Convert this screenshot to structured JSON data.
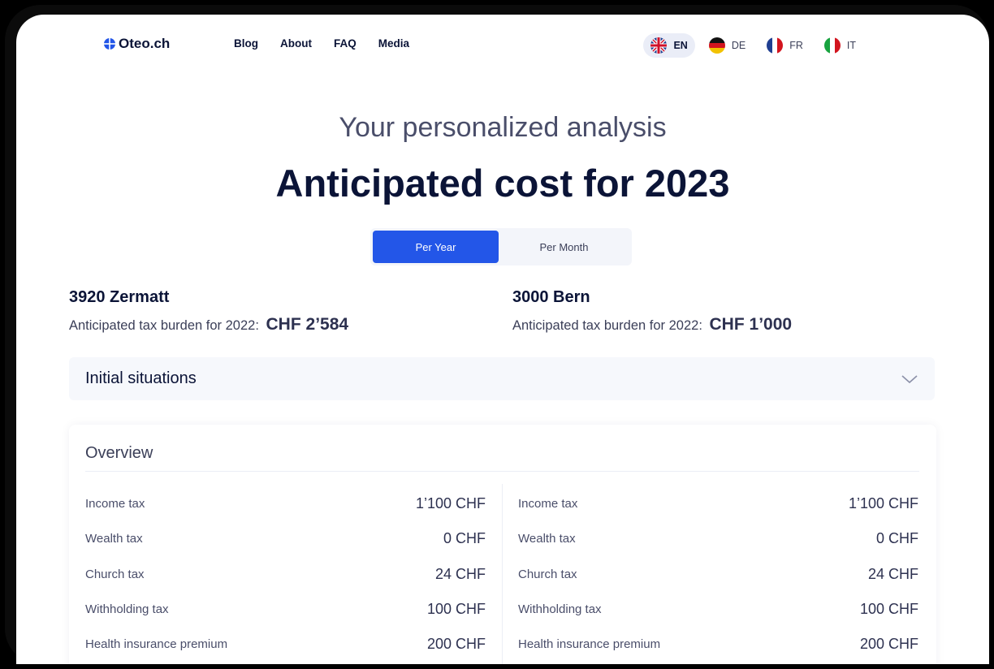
{
  "brand": {
    "name": "Oteo.ch"
  },
  "nav": [
    "Blog",
    "About",
    "FAQ",
    "Media"
  ],
  "languages": [
    {
      "code": "EN",
      "flag": "uk-flag-icon",
      "active": true
    },
    {
      "code": "DE",
      "flag": "germany-flag-icon",
      "active": false
    },
    {
      "code": "FR",
      "flag": "france-flag-icon",
      "active": false
    },
    {
      "code": "IT",
      "flag": "italy-flag-icon",
      "active": false
    }
  ],
  "hero": {
    "subtitle": "Your personalized analysis",
    "title": "Anticipated cost for 2023"
  },
  "period_toggle": {
    "options": [
      "Per Year",
      "Per Month"
    ],
    "selected": "Per Year"
  },
  "locations": [
    {
      "city": "3920 Zermatt",
      "burden_label": "Anticipated  tax burden for 2022:",
      "burden_value": "CHF 2’584"
    },
    {
      "city": "3000 Bern",
      "burden_label": "Anticipated  tax burden for 2022:",
      "burden_value": "CHF 1’000"
    }
  ],
  "accordion": {
    "label": "Initial situations",
    "icon": "chevron-down-icon"
  },
  "overview": {
    "title": "Overview",
    "columns": [
      [
        {
          "label": "Income tax",
          "value": "1’100 CHF"
        },
        {
          "label": "Wealth tax",
          "value": "0 CHF"
        },
        {
          "label": "Church tax",
          "value": "24 CHF"
        },
        {
          "label": "Withholding tax",
          "value": "100 CHF"
        },
        {
          "label": "Health insurance premium",
          "value": "200 CHF"
        }
      ],
      [
        {
          "label": "Income tax",
          "value": "1’100 CHF"
        },
        {
          "label": "Wealth tax",
          "value": "0 CHF"
        },
        {
          "label": "Church tax",
          "value": "24 CHF"
        },
        {
          "label": "Withholding tax",
          "value": "100 CHF"
        },
        {
          "label": "Health insurance premium",
          "value": "200 CHF"
        }
      ]
    ]
  },
  "colors": {
    "accent": "#2356e8",
    "text_dark": "#0b1437",
    "panel_bg": "#f6f8fc"
  }
}
